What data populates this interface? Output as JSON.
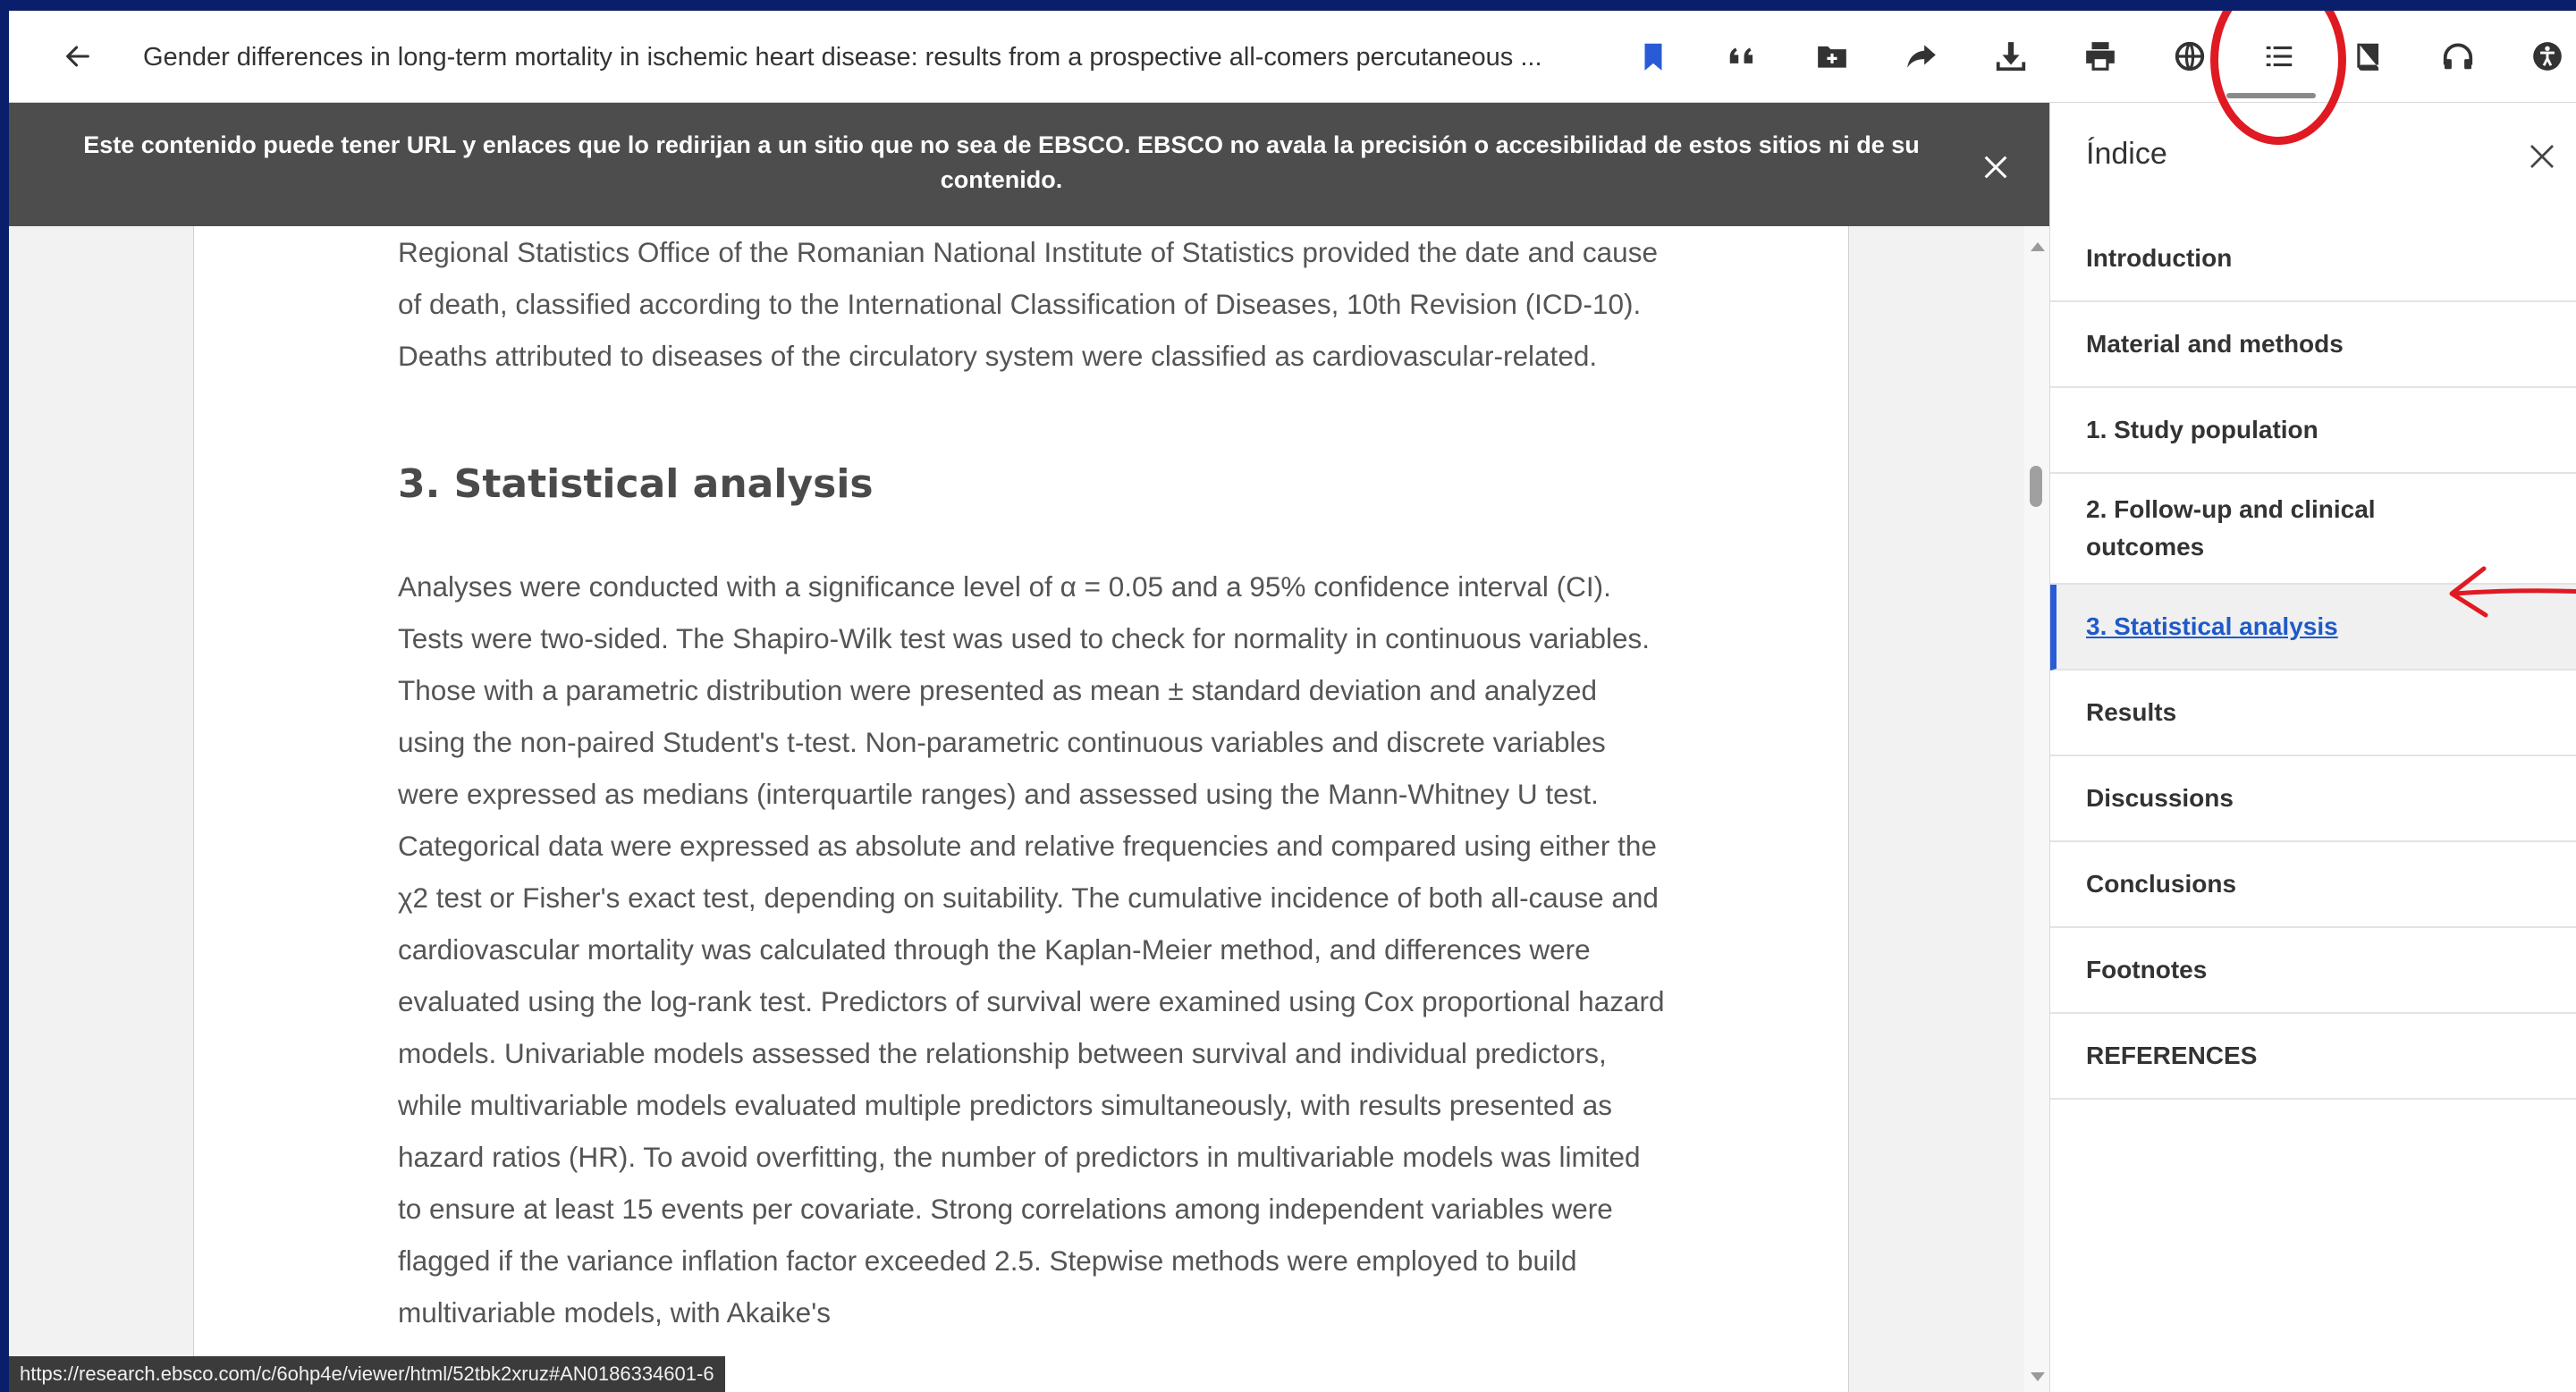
{
  "toolbar": {
    "doc_title": "Gender differences in long-term mortality in ischemic heart disease: results from a prospective all-comers percutaneous ...",
    "icons": [
      "back-arrow-icon",
      "bookmark-icon",
      "quote-icon",
      "add-folder-icon",
      "share-icon",
      "download-icon",
      "print-icon",
      "translate-globe-icon",
      "table-of-contents-icon",
      "book-icon",
      "headphones-icon",
      "accessibility-icon"
    ]
  },
  "colors": {
    "frame": "#0a1f6b",
    "bookmark": "#2a5bd7",
    "notice_bg": "#4d4d4d",
    "active_link": "#1f5ac7",
    "annotation_red": "#e01a22"
  },
  "notice": {
    "text": "Este contenido puede tener URL y enlaces que lo redirijan a un sitio que no sea de EBSCO. EBSCO no avala la precisión o accesibilidad de estos sitios ni de su contenido."
  },
  "article": {
    "para1": "Regional Statistics Office of the Romanian National Institute of Statistics provided the date and cause of death, classified according to the International Classification of Diseases, 10th Revision (ICD-10). Deaths attributed to diseases of the circulatory system were classified as cardiovascular-related.",
    "heading": "3. Statistical analysis",
    "para2": "Analyses were conducted with a significance level of α = 0.05 and a 95% confidence interval (CI). Tests were two-sided. The Shapiro-Wilk test was used to check for normality in continuous variables. Those with a parametric distribution were presented as mean ± standard deviation and analyzed using the non-paired Student's t-test. Non-parametric continuous variables and discrete variables were expressed as medians (interquartile ranges) and assessed using the Mann-Whitney U test. Categorical data were expressed as absolute and relative frequencies and compared using either the χ2 test or Fisher's exact test, depending on suitability. The cumulative incidence of both all-cause and cardiovascular mortality was calculated through the Kaplan-Meier method, and differences were evaluated using the log-rank test. Predictors of survival were examined using Cox proportional hazard models. Univariable models assessed the relationship between survival and individual predictors, while multivariable models evaluated multiple predictors simultaneously, with results presented as hazard ratios (HR). To avoid overfitting, the number of predictors in multivariable models was limited to ensure at least 15 events per covariate. Strong correlations among independent variables were flagged if the variance inflation factor exceeded 2.5. Stepwise methods were employed to build multivariable models, with Akaike's"
  },
  "status_url": "https://research.ebsco.com/c/6ohp4e/viewer/html/52tbk2xruz#AN0186334601-6",
  "toc": {
    "title": "Índice",
    "items": [
      {
        "label": "Introduction"
      },
      {
        "label": "Material and methods"
      },
      {
        "label": "1. Study population"
      },
      {
        "label": "2. Follow-up and clinical outcomes"
      },
      {
        "label": "3. Statistical analysis"
      },
      {
        "label": "Results"
      },
      {
        "label": "Discussions"
      },
      {
        "label": "Conclusions"
      },
      {
        "label": "Footnotes"
      },
      {
        "label": "REFERENCES"
      }
    ]
  }
}
